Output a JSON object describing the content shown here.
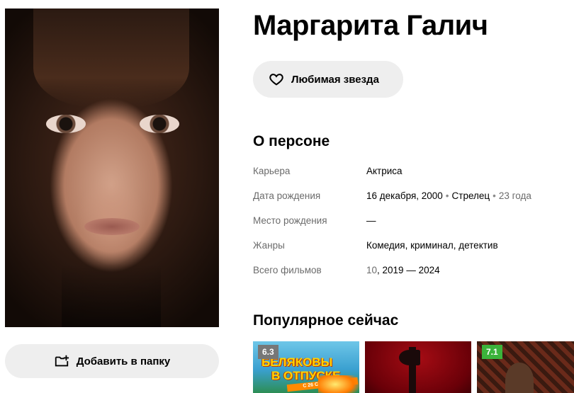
{
  "person": {
    "name": "Маргарита Галич",
    "photo_alt": "Маргарита Галич"
  },
  "buttons": {
    "favorite_label": "Любимая звезда",
    "favorite_icon": "heart-icon",
    "add_folder_label": "Добавить в папку",
    "add_folder_icon": "folder-add-icon"
  },
  "about": {
    "title": "О персоне",
    "rows": [
      {
        "key": "Карьера",
        "value": "Актриса"
      },
      {
        "key": "Дата рождения",
        "value": "16 декабря, 2000",
        "sign": "Стрелец",
        "age": "23 года"
      },
      {
        "key": "Место рождения",
        "value": "—"
      },
      {
        "key": "Жанры",
        "value": "Комедия, криминал, детектив"
      },
      {
        "key": "Всего фильмов",
        "count": "10",
        "value": ", 2019 — 2024"
      }
    ]
  },
  "popular": {
    "title": "Популярное сейчас",
    "cards": [
      {
        "rating": "6.3",
        "rating_color": "#777777",
        "poster_title_line1": "БЕЛЯКОВЫ",
        "poster_title_line2": "В ОТПУСКЕ",
        "poster_tagline": "С 26 СЕНТЯБРЯ"
      },
      {
        "rating": ""
      },
      {
        "rating": "7.1",
        "rating_color": "#3bb33b"
      }
    ]
  },
  "colors": {
    "button_bg": "#eeeeee",
    "muted_text": "#6b6b6b",
    "rating_green": "#3bb33b",
    "rating_grey": "#777777"
  }
}
